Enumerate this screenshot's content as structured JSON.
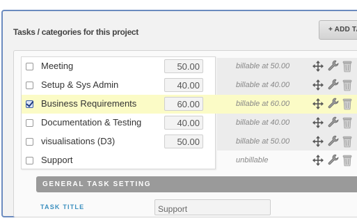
{
  "section": {
    "title": "Tasks / categories for this project",
    "add_button_label": "+ ADD TA"
  },
  "tasks": [
    {
      "name": "Meeting",
      "rate": "50.00",
      "billing": "billable at 50.00",
      "checked": false,
      "selected": false
    },
    {
      "name": "Setup & Sys Admin",
      "rate": "40.00",
      "billing": "billable at 40.00",
      "checked": false,
      "selected": false
    },
    {
      "name": "Business Requirements",
      "rate": "60.00",
      "billing": "billable at 60.00",
      "checked": true,
      "selected": true
    },
    {
      "name": "Documentation & Testing",
      "rate": "40.00",
      "billing": "billable at 40.00",
      "checked": false,
      "selected": false
    },
    {
      "name": "visualisations (D3)",
      "rate": "50.00",
      "billing": "billable at 50.00",
      "checked": false,
      "selected": false
    },
    {
      "name": "Support",
      "rate": null,
      "billing": "unbillable",
      "checked": false,
      "selected": false
    }
  ],
  "icons": [
    "move-icon",
    "wrench-icon",
    "trash-icon"
  ],
  "general_setting": {
    "header": "GENERAL TASK SETTING",
    "task_title_label": "TASK TITLE",
    "task_title_value": "Support"
  },
  "colors": {
    "selected_row": "#fbfbc6",
    "label_blue": "#3a8fbf",
    "frame_border": "#6b8bbf"
  }
}
